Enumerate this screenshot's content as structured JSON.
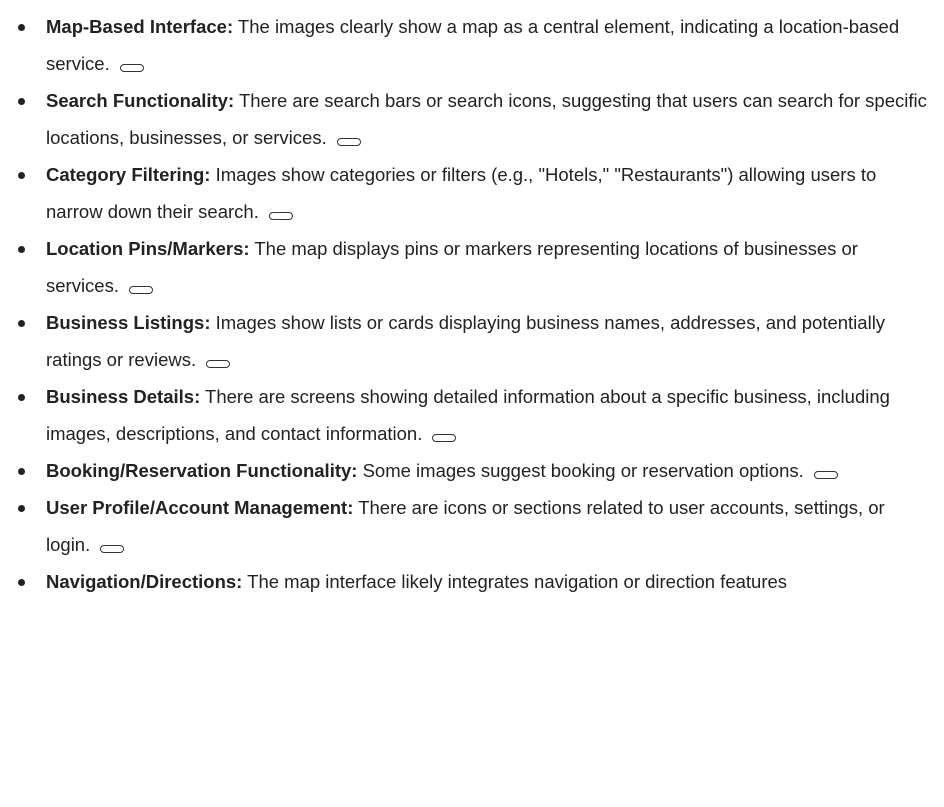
{
  "features": [
    {
      "term": "Map-Based Interface:",
      "desc": "The images clearly show a map as a central element, indicating a location-based service."
    },
    {
      "term": "Search Functionality:",
      "desc": "There are search bars or search icons, suggesting that users can search for specific locations, businesses, or services."
    },
    {
      "term": "Category Filtering:",
      "desc": "Images show categories or filters (e.g., \"Hotels,\" \"Restaurants\") allowing users to narrow down their search."
    },
    {
      "term": "Location Pins/Markers:",
      "desc": "The map displays pins or markers representing locations of businesses or services."
    },
    {
      "term": "Business Listings:",
      "desc": "Images show lists or cards displaying business names, addresses, and potentially ratings or reviews."
    },
    {
      "term": "Business Details:",
      "desc": "There are screens showing detailed information about a specific business, including images, descriptions, and contact information."
    },
    {
      "term": "Booking/Reservation Functionality:",
      "desc": "Some images suggest booking or reservation options."
    },
    {
      "term": "User Profile/Account Management:",
      "desc": "There are icons or sections related to user accounts, settings, or login."
    },
    {
      "term": "Navigation/Directions:",
      "desc": "The map interface likely integrates navigation or direction features"
    }
  ]
}
